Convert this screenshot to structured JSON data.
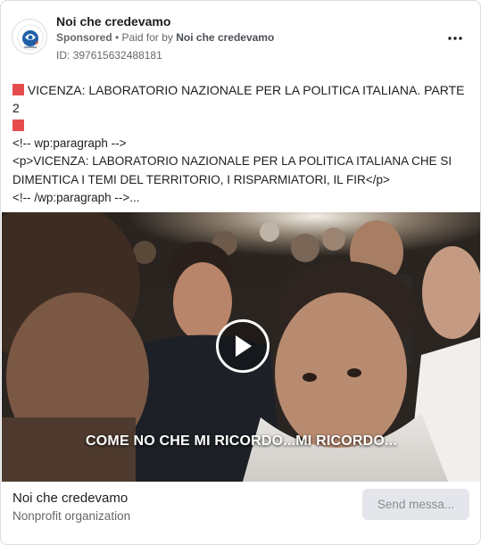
{
  "ad": {
    "page_name": "Noi che credevamo",
    "sponsored": "Sponsored",
    "paid_for_prefix": "• Paid for by",
    "paid_for_name": "Noi che credevamo",
    "id_label": "ID: 397615632488181"
  },
  "body": {
    "headline": "VICENZA: LABORATORIO NAZIONALE PER LA POLITICA ITALIANA. PARTE 2",
    "para_line1": "<!-- wp:paragraph -->",
    "para_line2": "<p>VICENZA: LABORATORIO NAZIONALE PER LA POLITICA ITALIANA CHE SI",
    "para_line3": "DIMENTICA I TEMI DEL TERRITORIO, I RISPARMIATORI, IL FIR</p>",
    "para_line4": "<!-- /wp:paragraph -->..."
  },
  "media": {
    "caption": "COME NO CHE MI RICORDO...MI RICORDO..."
  },
  "footer": {
    "name": "Noi che credevamo",
    "category": "Nonprofit organization",
    "send_button": "Send messa..."
  },
  "icons": {
    "more": "more-horizontal-icon",
    "play": "play-icon",
    "headline_marker": "red-square-icon"
  },
  "colors": {
    "headline_marker": "#e74c4c",
    "button_bg": "#e4e6eb",
    "secondary_text": "#65676b"
  }
}
